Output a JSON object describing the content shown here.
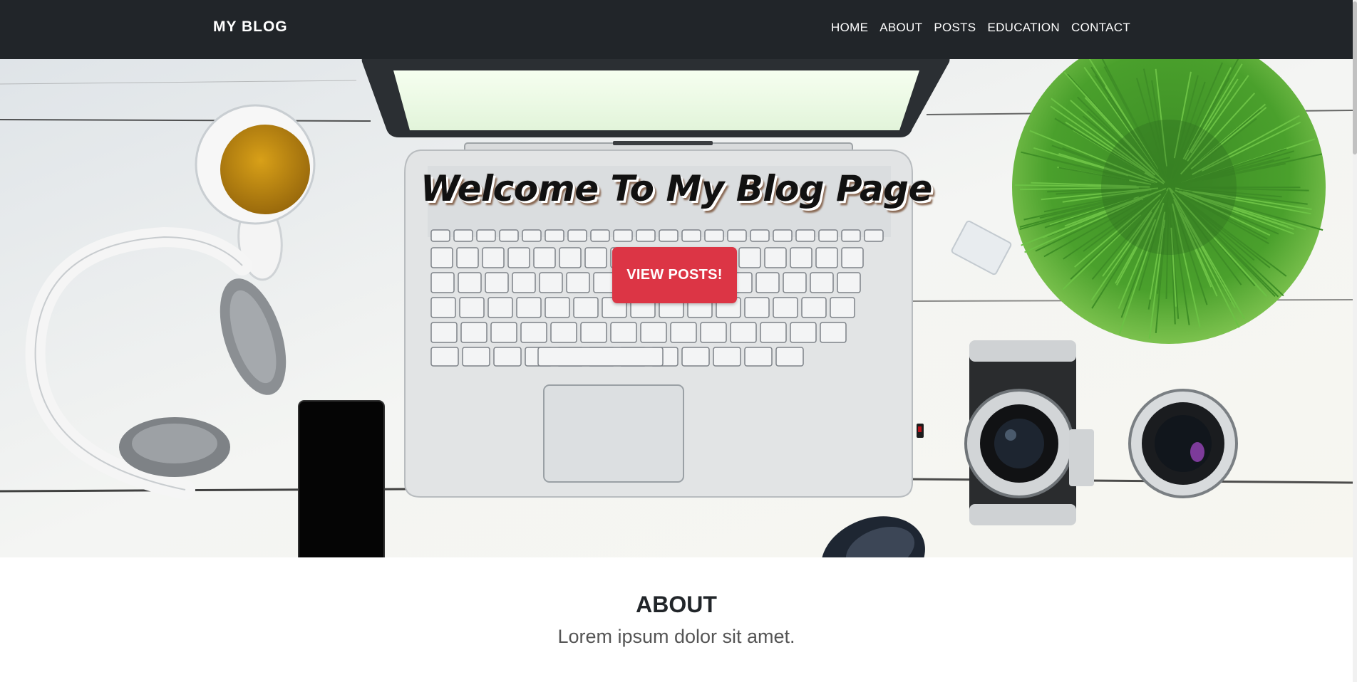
{
  "nav": {
    "brand": "MY BLOG",
    "links": [
      "HOME",
      "ABOUT",
      "POSTS",
      "EDUCATION",
      "CONTACT"
    ]
  },
  "hero": {
    "title": "Welcome To My Blog Page",
    "button_label": "VIEW POSTS!"
  },
  "about": {
    "title": "ABOUT",
    "lead": "Lorem ipsum dolor sit amet."
  },
  "colors": {
    "navbar_bg": "#212529",
    "button_red": "#dc3545",
    "text_dark": "#212529",
    "text_muted": "#555555"
  },
  "icons": [
    "laptop-image",
    "coffee-cup-image",
    "headphones-image",
    "smartphone-image",
    "plant-image",
    "camera-image",
    "lens-image",
    "mouse-image"
  ]
}
